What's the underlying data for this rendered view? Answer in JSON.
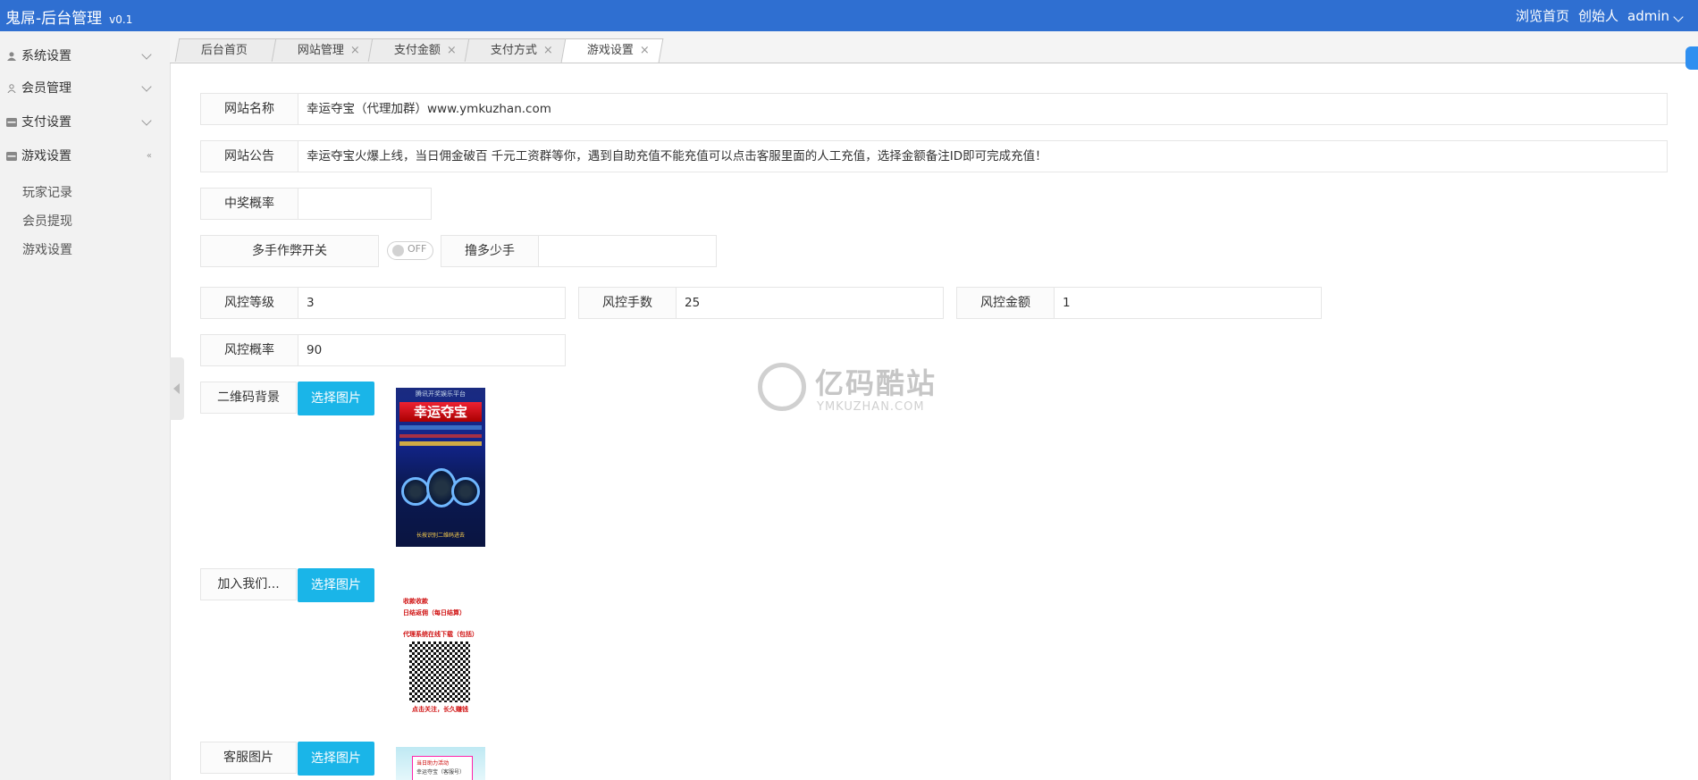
{
  "header": {
    "brand": "鬼屌-后台管理",
    "version": "v0.1",
    "links": [
      "浏览首页",
      "创始人"
    ],
    "user": "admin",
    "bg_color": "#2f6fd1"
  },
  "sidebar": {
    "menu": [
      {
        "label": "系统设置",
        "icon": "user-icon"
      },
      {
        "label": "会员管理",
        "icon": "user-outline-icon"
      },
      {
        "label": "支付设置",
        "icon": "card-icon"
      },
      {
        "label": "游戏设置",
        "icon": "card-icon"
      }
    ],
    "submenu": [
      "玩家记录",
      "会员提现",
      "游戏设置"
    ]
  },
  "tabs": [
    {
      "label": "后台首页",
      "closable": false
    },
    {
      "label": "网站管理",
      "closable": true
    },
    {
      "label": "支付金额",
      "closable": true
    },
    {
      "label": "支付方式",
      "closable": true
    },
    {
      "label": "游戏设置",
      "closable": true,
      "active": true
    }
  ],
  "form": {
    "site_name": {
      "label": "网站名称",
      "value": "幸运夺宝（代理加群）www.ymkuzhan.com"
    },
    "notice": {
      "label": "网站公告",
      "value": "幸运夺宝火爆上线，当日佣金破百  千元工资群等你，遇到自助充值不能充值可以点击客服里面的人工充值，选择金额备注ID即可完成充值！"
    },
    "win_rate": {
      "label": "中奖概率",
      "value": ""
    },
    "multi_cheat": {
      "label": "多手作弊开关",
      "switch_text": "OFF"
    },
    "lu_count": {
      "label": "撸多少手",
      "value": ""
    },
    "risk_level": {
      "label": "风控等级",
      "value": "3"
    },
    "risk_hands": {
      "label": "风控手数",
      "value": "25"
    },
    "risk_amount": {
      "label": "风控金额",
      "value": "1"
    },
    "risk_rate": {
      "label": "风控概率",
      "value": "90"
    },
    "qr_bg": {
      "label": "二维码背景",
      "button": "选择图片"
    },
    "join_us": {
      "label": "加入我们...",
      "button": "选择图片"
    },
    "service_img": {
      "label": "客服图片",
      "button": "选择图片"
    },
    "button_color": "#1ab5e8"
  },
  "images": {
    "poster1": {
      "top": "腾讯开奖娱乐平台",
      "title": "幸运夺宝",
      "bottom": "长按识别二维码进去"
    },
    "poster2": {
      "lines": [
        "收款收款",
        "日结返佣（每日结算）",
        "代理系统在线下载（包括）",
        "点击关注，长久赚钱"
      ]
    },
    "poster3": {
      "lines": [
        "当日助力活动",
        "幸运夺宝（客服号）"
      ]
    }
  },
  "watermark": {
    "cn": "亿码酷站",
    "en": "YMKUZHAN.COM"
  }
}
